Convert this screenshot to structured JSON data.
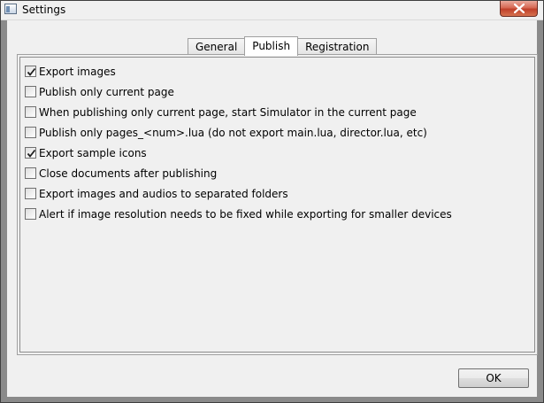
{
  "window": {
    "title": "Settings",
    "icon": "window-app-icon",
    "close_icon": "close-icon"
  },
  "tabs": [
    {
      "label": "General",
      "active": false
    },
    {
      "label": "Publish",
      "active": true
    },
    {
      "label": "Registration",
      "active": false
    }
  ],
  "publish_options": [
    {
      "label": "Export images",
      "checked": true
    },
    {
      "label": "Publish only current page",
      "checked": false
    },
    {
      "label": "When publishing only current page, start Simulator in the current page",
      "checked": false
    },
    {
      "label": "Publish only pages_<num>.lua (do not export main.lua, director.lua, etc)",
      "checked": false
    },
    {
      "label": "Export sample icons",
      "checked": true
    },
    {
      "label": "Close documents after publishing",
      "checked": false
    },
    {
      "label": "Export images and audios to separated folders",
      "checked": false
    },
    {
      "label": "Alert if image resolution needs to be fixed while exporting for smaller devices",
      "checked": false
    }
  ],
  "buttons": {
    "ok_label": "OK"
  },
  "colors": {
    "dialog_background": "#f0f0f0",
    "close_button": "#c0402a",
    "frame": "#8a8a8a"
  }
}
